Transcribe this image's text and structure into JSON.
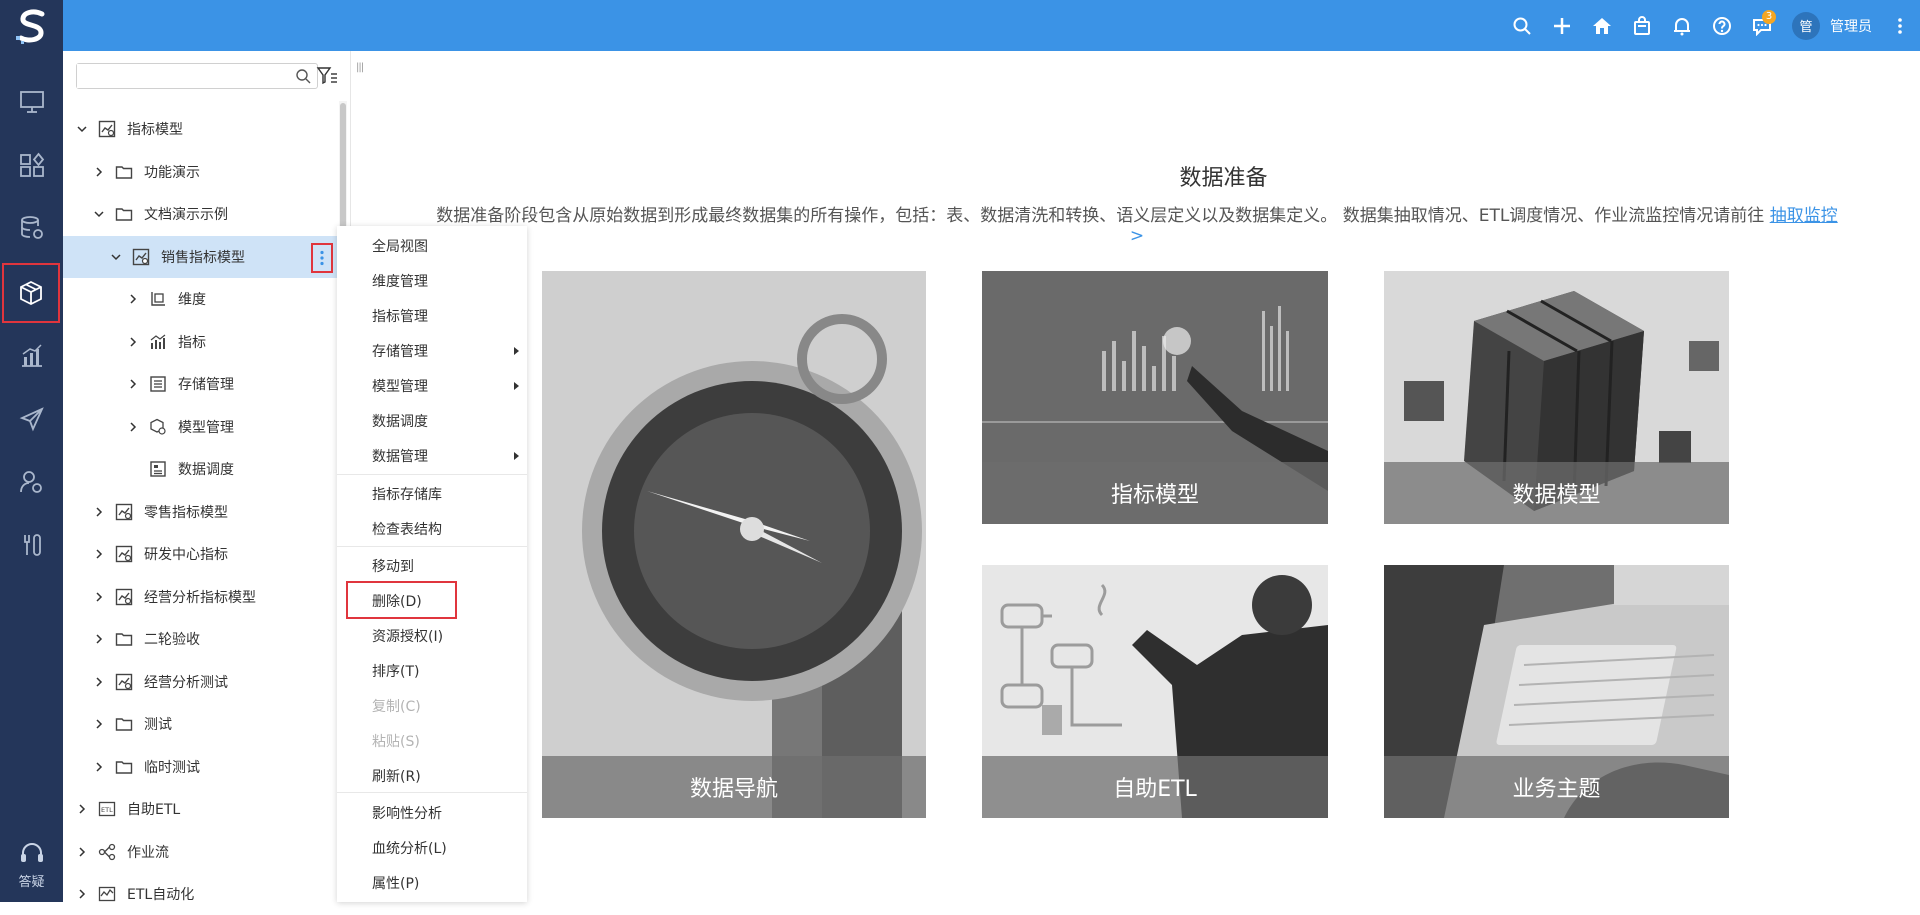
{
  "header": {
    "logo": "S",
    "notification_count": "3",
    "avatar_text": "管",
    "username": "管理员",
    "icons": [
      "search-icon",
      "plus-icon",
      "home-icon",
      "bag-icon",
      "bell-icon",
      "help-icon",
      "chat-icon",
      "more-icon"
    ]
  },
  "rail": {
    "items": [
      "monitor-icon",
      "apps-icon",
      "database-gear-icon",
      "cube-icon",
      "bar-chart-icon",
      "send-icon",
      "user-gear-icon",
      "tools-icon"
    ],
    "help_label": "答疑"
  },
  "tree": {
    "search_placeholder": "",
    "nodes": [
      {
        "label": "指标模型",
        "level": 0,
        "expanded": true,
        "icon": "metric-model-icon"
      },
      {
        "label": "功能演示",
        "level": 1,
        "expanded": false,
        "icon": "folder-icon"
      },
      {
        "label": "文档演示示例",
        "level": 1,
        "expanded": true,
        "icon": "folder-icon"
      },
      {
        "label": "销售指标模型",
        "level": 2,
        "expanded": true,
        "icon": "metric-model-icon",
        "selected": true
      },
      {
        "label": "维度",
        "level": 3,
        "expanded": false,
        "icon": "dimension-icon"
      },
      {
        "label": "指标",
        "level": 3,
        "expanded": false,
        "icon": "metric-icon"
      },
      {
        "label": "存储管理",
        "level": 3,
        "expanded": false,
        "icon": "storage-icon"
      },
      {
        "label": "模型管理",
        "level": 3,
        "expanded": false,
        "icon": "model-gear-icon"
      },
      {
        "label": "数据调度",
        "level": 3,
        "expanded": null,
        "icon": "schedule-icon"
      },
      {
        "label": "零售指标模型",
        "level": 1,
        "expanded": false,
        "icon": "metric-model-icon"
      },
      {
        "label": "研发中心指标",
        "level": 1,
        "expanded": false,
        "icon": "metric-model-icon"
      },
      {
        "label": "经营分析指标模型",
        "level": 1,
        "expanded": false,
        "icon": "metric-model-icon"
      },
      {
        "label": "二轮验收",
        "level": 1,
        "expanded": false,
        "icon": "folder-icon"
      },
      {
        "label": "经营分析测试",
        "level": 1,
        "expanded": false,
        "icon": "metric-model-icon"
      },
      {
        "label": "测试",
        "level": 1,
        "expanded": false,
        "icon": "folder-icon"
      },
      {
        "label": "临时测试",
        "level": 1,
        "expanded": false,
        "icon": "folder-icon"
      },
      {
        "label": "自助ETL",
        "level": 0,
        "expanded": false,
        "icon": "etl-icon"
      },
      {
        "label": "作业流",
        "level": 0,
        "expanded": false,
        "icon": "workflow-icon"
      },
      {
        "label": "ETL自动化",
        "level": 0,
        "expanded": false,
        "icon": "etl-auto-icon"
      }
    ]
  },
  "context_menu": {
    "items": [
      {
        "label": "全局视图",
        "submenu": false,
        "disabled": false
      },
      {
        "label": "维度管理",
        "submenu": false,
        "disabled": false
      },
      {
        "label": "指标管理",
        "submenu": false,
        "disabled": false
      },
      {
        "label": "存储管理",
        "submenu": true,
        "disabled": false
      },
      {
        "label": "模型管理",
        "submenu": true,
        "disabled": false
      },
      {
        "label": "数据调度",
        "submenu": false,
        "disabled": false
      },
      {
        "label": "数据管理",
        "submenu": true,
        "disabled": false
      },
      {
        "label": "指标存储库",
        "submenu": false,
        "disabled": false
      },
      {
        "label": "检查表结构",
        "submenu": false,
        "disabled": false
      },
      {
        "label": "移动到",
        "submenu": false,
        "disabled": false
      },
      {
        "label": "删除(D)",
        "submenu": false,
        "disabled": false,
        "highlighted": true
      },
      {
        "label": "资源授权(I)",
        "submenu": false,
        "disabled": false
      },
      {
        "label": "排序(T)",
        "submenu": false,
        "disabled": false
      },
      {
        "label": "复制(C)",
        "submenu": false,
        "disabled": true
      },
      {
        "label": "粘贴(S)",
        "submenu": false,
        "disabled": true
      },
      {
        "label": "刷新(R)",
        "submenu": false,
        "disabled": false
      },
      {
        "label": "影响性分析",
        "submenu": false,
        "disabled": false
      },
      {
        "label": "血统分析(L)",
        "submenu": false,
        "disabled": false
      },
      {
        "label": "属性(P)",
        "submenu": false,
        "disabled": false
      }
    ]
  },
  "main": {
    "title": "数据准备",
    "description": "数据准备阶段包含从原始数据到形成最终数据集的所有操作，包括：表、数据清洗和转换、语义层定义以及数据集定义。 数据集抽取情况、ETL调度情况、作业流监控情况请前往 ",
    "description_link": "抽取监控",
    "description_link_suffix": ">",
    "cards": [
      {
        "label": "数据导航",
        "image": "compass"
      },
      {
        "label": "指标模型",
        "image": "touch-chart"
      },
      {
        "label": "数据模型",
        "image": "cubes"
      },
      {
        "label": "自助ETL",
        "image": "whiteboard"
      },
      {
        "label": "业务主题",
        "image": "laptop"
      }
    ]
  },
  "colors": {
    "header": "#3b93e6",
    "rail": "#24365a",
    "selected_row": "#cfe3f7",
    "highlight_border": "#e0353d",
    "link": "#3b93e6"
  }
}
